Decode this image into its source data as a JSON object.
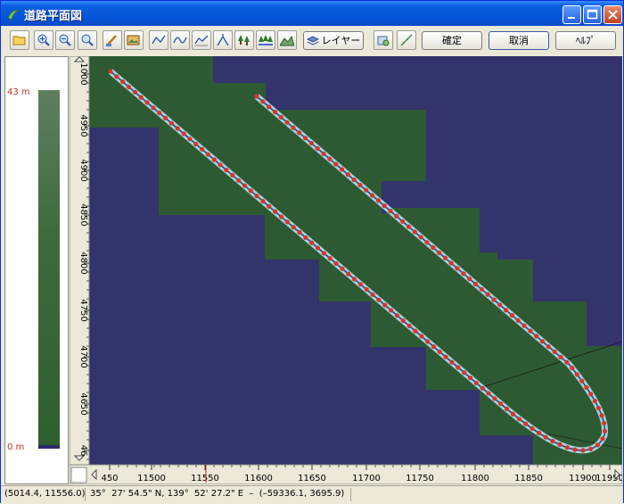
{
  "window": {
    "title": "道路平面図"
  },
  "toolbar": {
    "layer_label": "レイヤー",
    "confirm_label": "確定",
    "cancel_label": "取消",
    "help_label": "ﾍﾙﾌﾟ"
  },
  "elevation": {
    "top_label": "43 m",
    "bottom_label": "0 m"
  },
  "map": {
    "x_ticks": [
      "450",
      "11500",
      "11550",
      "11600",
      "11650",
      "11700",
      "11750",
      "11800",
      "11850",
      "11900",
      "11950"
    ],
    "y_ticks": [
      "1000",
      "4950",
      "4900",
      "4850",
      "4800",
      "4750",
      "4700",
      "4650",
      "46"
    ],
    "colors": {
      "background": "#34346C",
      "terrain": "#2D5A32",
      "road": "#9ED6E0",
      "point": "#E0302A"
    }
  },
  "status": {
    "coords": "(5014.4, 11556.0)",
    "latlon": "35°  27' 54.5\" N, 139°  52' 27.2\" E  –  (–59336.1, 3695.9)"
  }
}
